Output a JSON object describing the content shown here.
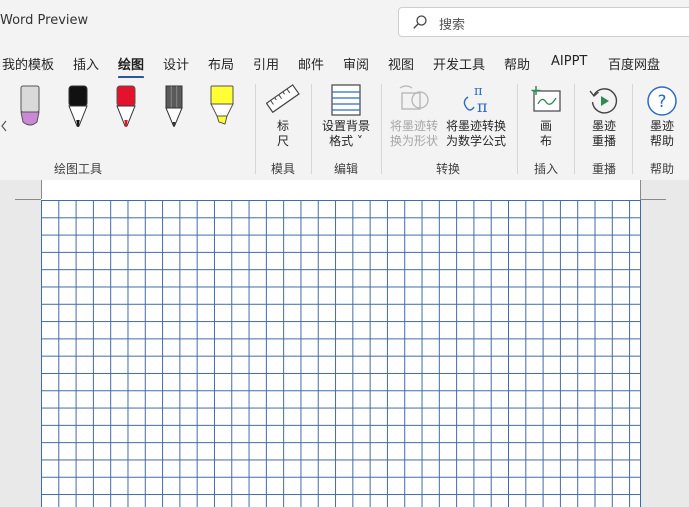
{
  "app": {
    "title": "Word Preview"
  },
  "search": {
    "placeholder": "搜索"
  },
  "tabs": [
    {
      "label": "我的模板",
      "active": false
    },
    {
      "label": "插入",
      "active": false
    },
    {
      "label": "绘图",
      "active": true
    },
    {
      "label": "设计",
      "active": false
    },
    {
      "label": "布局",
      "active": false
    },
    {
      "label": "引用",
      "active": false
    },
    {
      "label": "邮件",
      "active": false
    },
    {
      "label": "审阅",
      "active": false
    },
    {
      "label": "视图",
      "active": false
    },
    {
      "label": "开发工具",
      "active": false
    },
    {
      "label": "帮助",
      "active": false
    },
    {
      "label": "AIPPT",
      "active": false
    },
    {
      "label": "百度网盘",
      "active": false
    }
  ],
  "ribbon": {
    "drawing_tools": {
      "label": "绘图工具",
      "pens": [
        {
          "name": "eraser-pen",
          "color": "#c989d6"
        },
        {
          "name": "black-pen",
          "color": "#111111"
        },
        {
          "name": "red-pen",
          "color": "#e3132c"
        },
        {
          "name": "pencil",
          "color": "#5a5a5a"
        },
        {
          "name": "highlighter",
          "color": "#ffff33"
        }
      ]
    },
    "stencils": {
      "label": "模具",
      "ruler": "标\n尺"
    },
    "edit": {
      "label": "编辑",
      "background_format": "设置背景\n格式 ˅"
    },
    "convert": {
      "label": "转换",
      "ink_to_shape": "将墨迹转\n换为形状",
      "ink_to_math": "将墨迹转换\n为数学公式"
    },
    "insert": {
      "label": "插入",
      "canvas": "画\n布"
    },
    "replay": {
      "label": "重播",
      "ink_replay": "墨迹\n重播"
    },
    "help": {
      "label": "帮助",
      "ink_help": "墨迹\n帮助"
    }
  },
  "colors": {
    "accent": "#2b579a",
    "grid_line": "#3f6aa8",
    "help_icon": "#2b6cc4",
    "replay_icon": "#2e8b57"
  }
}
